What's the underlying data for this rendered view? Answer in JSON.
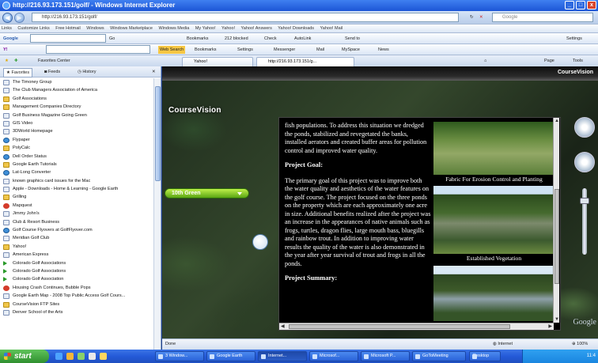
{
  "window": {
    "title": "http://216.93.173.151/golf/ - Windows Internet Explorer"
  },
  "address_bar": {
    "url": "http://216.93.173.151/golf/",
    "search_placeholder": "Google"
  },
  "links_bar": {
    "items": [
      "Links",
      "Customize Links",
      "Free Hotmail",
      "Windows",
      "Windows Marketplace",
      "Windows Media",
      "My Yahoo!",
      "Yahoo!",
      "Yahoo! Answers",
      "Yahoo! Downloads",
      "Yahoo! Mail"
    ]
  },
  "google_toolbar": {
    "label": "Google",
    "go_label": "Go",
    "bookmarks_label": "Bookmarks",
    "blocked_label": "212 blocked",
    "check_label": "Check",
    "autolink_label": "AutoLink",
    "sendto_label": "Send to",
    "settings_label": "Settings"
  },
  "yahoo_toolbar": {
    "web_search_label": "Web Search",
    "bookmarks_label": "Bookmarks",
    "settings_label": "Settings",
    "messenger_label": "Messenger",
    "mail_label": "Mail",
    "myspace_label": "MySpace",
    "news_label": "News"
  },
  "favorites_center": {
    "label": "Favorites Center"
  },
  "tabs": [
    {
      "label": "Yahoo!"
    },
    {
      "label": "http://216.93.173.151/g..."
    }
  ],
  "command_bar": {
    "page_label": "Page",
    "tools_label": "Tools"
  },
  "favorites_panel": {
    "favorites_tab": "Favorites",
    "feeds_tab": "Feeds",
    "history_tab": "History",
    "items": [
      {
        "label": "The Timoney Group",
        "icon": "page"
      },
      {
        "label": "The Club Managers Association of America",
        "icon": "page"
      },
      {
        "label": "Golf Associations",
        "icon": "folder"
      },
      {
        "label": "Management Companies Directory",
        "icon": "folder"
      },
      {
        "label": "Golf Business Magazine Going Green",
        "icon": "page"
      },
      {
        "label": "GIS Video",
        "icon": "page"
      },
      {
        "label": "3DWorld Homepage",
        "icon": "page"
      },
      {
        "label": "Flypaper",
        "icon": "globe"
      },
      {
        "label": "PolyCalc",
        "icon": "folder"
      },
      {
        "label": "Dell Order Status",
        "icon": "globe"
      },
      {
        "label": "Google Earth Tutorials",
        "icon": "folder"
      },
      {
        "label": "Lat-Long Converter",
        "icon": "globe"
      },
      {
        "label": "known graphics card issues for the Mac",
        "icon": "page"
      },
      {
        "label": "Apple - Downloads - Home & Learning - Google Earth",
        "icon": "page"
      },
      {
        "label": "Grilling",
        "icon": "folder"
      },
      {
        "label": "Mapquest",
        "icon": "red"
      },
      {
        "label": "Jimmy John's",
        "icon": "page"
      },
      {
        "label": "Club & Resort Business",
        "icon": "page"
      },
      {
        "label": "Golf Course Flyovers at GolfFlyover.com",
        "icon": "globe"
      },
      {
        "label": "Meridian Golf Club",
        "icon": "page"
      },
      {
        "label": "Yahoo!",
        "icon": "folder"
      },
      {
        "label": "American Express",
        "icon": "page"
      },
      {
        "label": "Colorado Golf Associations",
        "icon": "arrow"
      },
      {
        "label": "Colorado Golf Associations",
        "icon": "arrow"
      },
      {
        "label": "Colorado Golf Association",
        "icon": "arrow"
      },
      {
        "label": "Housing Crash Continues, Bubble Pops",
        "icon": "red"
      },
      {
        "label": "Google Earth Map - 2008 Top Public Access Golf Cours...",
        "icon": "page"
      },
      {
        "label": "CourseVision FTP Sites",
        "icon": "folder"
      },
      {
        "label": "Denver School of the Arts",
        "icon": "page"
      }
    ]
  },
  "coursevision": {
    "header_title": "CourseVision",
    "logo": "CourseVision",
    "hole_selector": "10th Green",
    "text_blocks": [
      {
        "kind": "p",
        "text": "fish populations. To address this situation we dredged the ponds, stabilized and revegetated the banks, installed aerators and created buffer areas for pollution control and improved water quality."
      },
      {
        "kind": "h",
        "text": "Project Goal:"
      },
      {
        "kind": "p",
        "text": "The primary goal of this project was to improve both the water quality and aesthetics of the water features on the golf course. The project focused on the three ponds on the property which are each approximately one acre in size. Additional benefits realized after the project was an increase in the appearances of native animals such as frogs, turtles, dragon flies, large mouth bass, bluegills and rainbow trout. In addition to improving water results the quality of the water is also demonstrated in the year after year survival of trout and frogs in all the ponds."
      },
      {
        "kind": "h",
        "text": "Project Summary:"
      }
    ],
    "captions": [
      "Fabric For Erosion Control and Planting",
      "Established Vegetation",
      ""
    ],
    "map_logo": "Google"
  },
  "status_bar": {
    "status": "Done",
    "zone": "Internet",
    "zoom": "100%"
  },
  "taskbar": {
    "start_label": "start",
    "buttons": [
      "3 Window...",
      "Google Earth",
      "Internet...",
      "Microsof...",
      "Microsoft P...",
      "GoToMeeting",
      "Desktop"
    ],
    "clock": "11:4"
  }
}
